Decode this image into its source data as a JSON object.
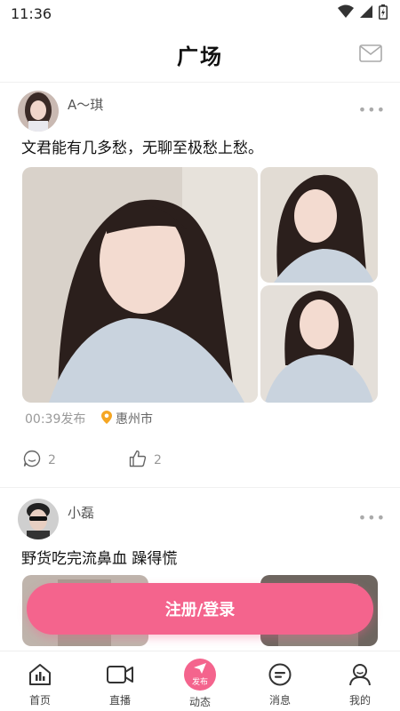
{
  "status_bar": {
    "time": "11:36"
  },
  "header": {
    "title": "广场"
  },
  "posts": [
    {
      "username": "A～琪",
      "text": "文君能有几多愁，无聊至极愁上愁。",
      "time": "00:39发布",
      "location": "惠州市",
      "comments": "2",
      "likes": "2"
    },
    {
      "username": "小磊",
      "text": "野货吃完流鼻血 躁得慌"
    }
  ],
  "login_button": "注册/登录",
  "bottom_nav": [
    {
      "label": "首页",
      "icon": "home-icon"
    },
    {
      "label": "直播",
      "icon": "video-camera-icon"
    },
    {
      "label": "动态",
      "icon": "publish-icon",
      "badge": "发布"
    },
    {
      "label": "消息",
      "icon": "message-icon"
    },
    {
      "label": "我的",
      "icon": "profile-icon"
    }
  ],
  "colors": {
    "accent": "#f4648d",
    "location_pin": "#f5a623"
  }
}
